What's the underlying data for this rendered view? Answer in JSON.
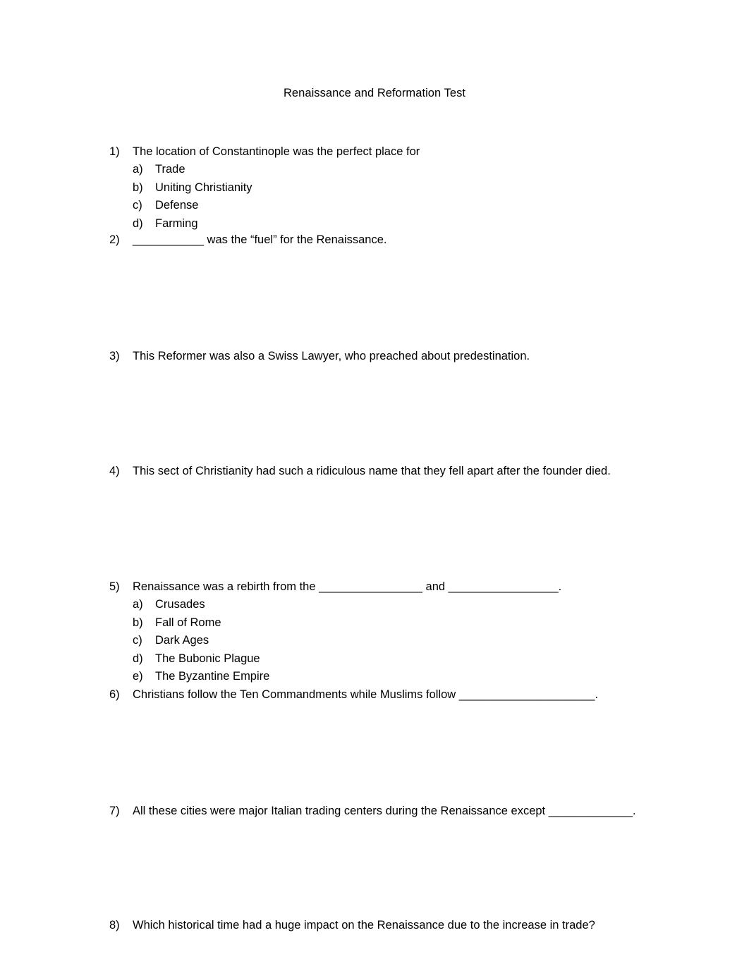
{
  "document": {
    "title": "Renaissance and Reformation Test",
    "page_background": "#ffffff",
    "text_color": "#000000"
  },
  "questions": [
    {
      "marker": "1)",
      "text": "The location of Constantinople was the perfect place for",
      "options": [
        {
          "marker": "a)",
          "text": "Trade"
        },
        {
          "marker": "b)",
          "text": "Uniting Christianity"
        },
        {
          "marker": "c)",
          "text": "Defense"
        },
        {
          "marker": "d)",
          "text": "Farming"
        }
      ]
    },
    {
      "marker": "2)",
      "text": "___________ was the “fuel” for the Renaissance.",
      "options": []
    },
    {
      "marker": "3)",
      "text": "This Reformer was also a Swiss Lawyer, who preached about predestination.",
      "options": []
    },
    {
      "marker": "4)",
      "text": "This sect of Christianity had such a ridiculous name that they fell apart after the founder died.",
      "options": []
    },
    {
      "marker": "5)",
      "text": "Renaissance was a rebirth from the ________________ and _________________.",
      "options": [
        {
          "marker": "a)",
          "text": "Crusades"
        },
        {
          "marker": "b)",
          "text": "Fall of Rome"
        },
        {
          "marker": "c)",
          "text": "Dark Ages"
        },
        {
          "marker": "d)",
          "text": "The Bubonic Plague"
        },
        {
          "marker": "e)",
          "text": "The Byzantine Empire"
        }
      ]
    },
    {
      "marker": "6)",
      "text": "Christians follow the Ten Commandments while Muslims follow _____________________.",
      "options": []
    },
    {
      "marker": "7)",
      "text": "All these cities were major Italian trading centers during the Renaissance except _____________.",
      "options": []
    },
    {
      "marker": "8)",
      "text": "Which historical time had a huge impact on the Renaissance due to the increase in trade?",
      "options": []
    }
  ]
}
